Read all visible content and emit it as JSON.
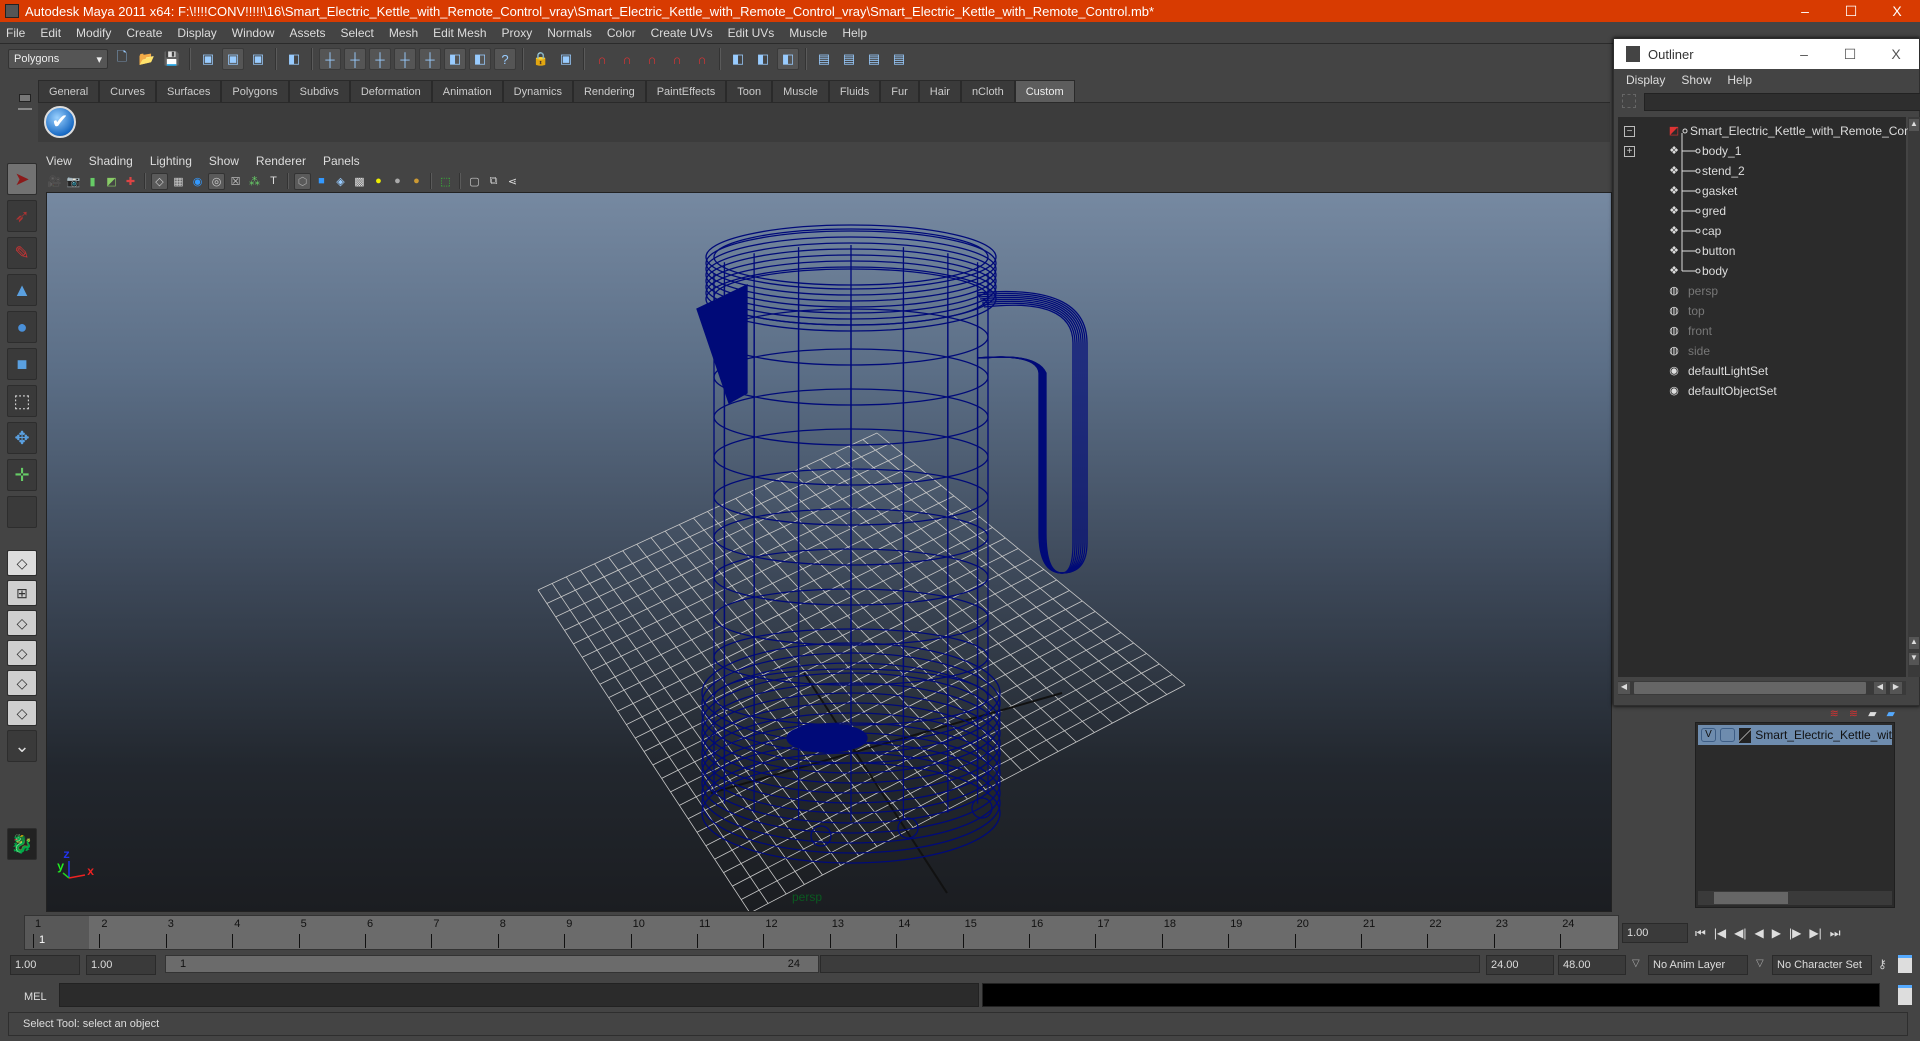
{
  "window": {
    "title": "Autodesk Maya 2011 x64: F:\\!!!!CONV!!!!!\\16\\Smart_Electric_Kettle_with_Remote_Control_vray\\Smart_Electric_Kettle_with_Remote_Control_vray\\Smart_Electric_Kettle_with_Remote_Control.mb*",
    "minimize": "–",
    "maximize": "☐",
    "close": "X",
    "accent": "#d83b01"
  },
  "menubar": [
    "File",
    "Edit",
    "Modify",
    "Create",
    "Display",
    "Window",
    "Assets",
    "Select",
    "Mesh",
    "Edit Mesh",
    "Proxy",
    "Normals",
    "Color",
    "Create UVs",
    "Edit UVs",
    "Muscle",
    "Help"
  ],
  "statusline": {
    "menuset": "Polygons",
    "icons": [
      "new-scene-icon",
      "open-scene-icon",
      "save-scene-icon",
      "select-hierarchy-icon",
      "select-object-icon",
      "select-component-icon",
      "filter-icon",
      "snap-grid-icon",
      "snap-curve-icon",
      "snap-point-icon",
      "snap-view-plane-icon",
      "snap-live-icon",
      "history-icon",
      "make-live-icon",
      "help-icon",
      "lock-icon",
      "selection-mask-icon",
      "magnet-grid-icon",
      "magnet-curve-icon",
      "magnet-point-icon",
      "magnet-plane-icon",
      "magnet-live-icon",
      "input-ops-icon",
      "output-ops-icon",
      "construction-history-icon",
      "render-view-icon",
      "render-icon",
      "ipr-render-icon",
      "render-settings-icon"
    ]
  },
  "shelf": {
    "tabs": [
      "General",
      "Curves",
      "Surfaces",
      "Polygons",
      "Subdivs",
      "Deformation",
      "Animation",
      "Dynamics",
      "Rendering",
      "PaintEffects",
      "Toon",
      "Muscle",
      "Fluids",
      "Fur",
      "Hair",
      "nCloth",
      "Custom"
    ],
    "active_tab": "Custom",
    "button_glyph": "✔"
  },
  "toolbox": {
    "tools": [
      {
        "name": "select-tool",
        "glyph": "➤",
        "color": "#8b1a1a"
      },
      {
        "name": "lasso-tool",
        "glyph": "➶",
        "color": "#aa3333"
      },
      {
        "name": "paint-select-tool",
        "glyph": "✎",
        "color": "#cc3333"
      },
      {
        "name": "move-tool",
        "glyph": "▲",
        "color": "#5aa0e0"
      },
      {
        "name": "rotate-tool",
        "glyph": "●",
        "color": "#4a90d9"
      },
      {
        "name": "scale-tool",
        "glyph": "■",
        "color": "#5aa0e0"
      },
      {
        "name": "universal-manipulator",
        "glyph": "⬚",
        "color": "#ddd"
      },
      {
        "name": "soft-mod-tool",
        "glyph": "✥",
        "color": "#5aa0e0"
      },
      {
        "name": "show-manipulator-tool",
        "glyph": "✛",
        "color": "#66cc66"
      },
      {
        "name": "last-tool",
        "glyph": "",
        "color": "#ddd"
      }
    ],
    "layouts": [
      "single-perspective-layout",
      "four-view-layout",
      "outliner-persp-layout",
      "persp-graph-layout",
      "hypershade-persp-layout",
      "persp-outliner-graph-layout"
    ]
  },
  "panel": {
    "menu": [
      "View",
      "Shading",
      "Lighting",
      "Show",
      "Renderer",
      "Panels"
    ],
    "icons": [
      "camera-select-icon",
      "camera-attributes-icon",
      "bookmark-icon",
      "image-plane-icon",
      "isolate-select-icon",
      "grid-toggle-icon",
      "film-gate-icon",
      "resolution-gate-icon",
      "gate-mask-icon",
      "field-chart-icon",
      "safe-action-icon",
      "safe-title-icon",
      "wireframe-icon",
      "smooth-shade-icon",
      "wireframe-on-shaded-icon",
      "textured-icon",
      "use-lights-icon",
      "shadows-icon",
      "high-quality-icon",
      "select-camera-icon",
      "xray-icon",
      "xray-joints-icon",
      "share-icon"
    ]
  },
  "viewport": {
    "camera_label": "persp",
    "axis": {
      "x": "x",
      "y": "y",
      "z": "z"
    },
    "wire_color": "#000a78",
    "grid_color": "#c8c8c8"
  },
  "outliner": {
    "title": "Outliner",
    "menu": [
      "Display",
      "Show",
      "Help"
    ],
    "filter_value": "",
    "items": [
      {
        "label": "Smart_Electric_Kettle_with_Remote_Control",
        "icon": "group-icon",
        "level": 0,
        "expander": "−",
        "dim": false
      },
      {
        "label": "body_1",
        "icon": "mesh-icon",
        "level": 1,
        "expander": "+",
        "dim": false
      },
      {
        "label": "stend_2",
        "icon": "mesh-icon",
        "level": 1,
        "dim": false
      },
      {
        "label": "gasket",
        "icon": "mesh-icon",
        "level": 1,
        "dim": false
      },
      {
        "label": "gred",
        "icon": "mesh-icon",
        "level": 1,
        "dim": false
      },
      {
        "label": "cap",
        "icon": "mesh-icon",
        "level": 1,
        "dim": false
      },
      {
        "label": "button",
        "icon": "mesh-icon",
        "level": 1,
        "dim": false
      },
      {
        "label": "body",
        "icon": "mesh-icon",
        "level": 1,
        "last": true,
        "dim": false
      },
      {
        "label": "persp",
        "icon": "camera-icon",
        "level": 0,
        "dim": true
      },
      {
        "label": "top",
        "icon": "camera-icon",
        "level": 0,
        "dim": true
      },
      {
        "label": "front",
        "icon": "camera-icon",
        "level": 0,
        "dim": true
      },
      {
        "label": "side",
        "icon": "camera-icon",
        "level": 0,
        "dim": true
      },
      {
        "label": "defaultLightSet",
        "icon": "set-icon",
        "level": 0,
        "dim": false
      },
      {
        "label": "defaultObjectSet",
        "icon": "set-icon",
        "level": 0,
        "dim": false
      }
    ]
  },
  "layers": {
    "rows": [
      {
        "visible": "V",
        "playback": "",
        "name": "Smart_Electric_Kettle_wit",
        "color": "#6e8cae"
      }
    ]
  },
  "timeline": {
    "ticks": [
      "1",
      "2",
      "3",
      "4",
      "5",
      "6",
      "7",
      "8",
      "9",
      "10",
      "11",
      "12",
      "13",
      "14",
      "15",
      "16",
      "17",
      "18",
      "19",
      "20",
      "21",
      "22",
      "23",
      "24"
    ],
    "current_frame_marker": "1",
    "current_frame": "1.00",
    "playback_buttons": [
      "⏮",
      "|◀",
      "◀|",
      "◀",
      "▶",
      "|▶",
      "▶|",
      "⏭"
    ]
  },
  "range": {
    "start": "1.00",
    "playback_start": "1.00",
    "slider_start": "1",
    "slider_end": "24",
    "playback_end": "24.00",
    "end": "48.00",
    "anim_layer": "No Anim Layer",
    "character_set": "No Character Set"
  },
  "command": {
    "label": "MEL",
    "value": ""
  },
  "help_line": "Select Tool: select an object"
}
